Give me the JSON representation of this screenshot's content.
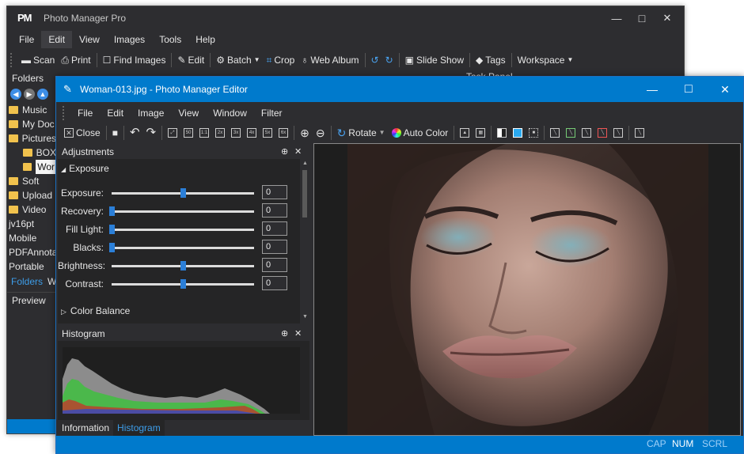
{
  "back_window": {
    "logo": "PM",
    "title": "Photo Manager Pro",
    "menu": [
      "File",
      "Edit",
      "View",
      "Images",
      "Tools",
      "Help"
    ],
    "active_menu": "Edit",
    "toolbar": [
      {
        "icon": "scan-icon",
        "label": "Scan"
      },
      {
        "icon": "print-icon",
        "label": "Print"
      },
      {
        "icon": "find-images-icon",
        "label": "Find Images"
      },
      {
        "icon": "edit-icon",
        "label": "Edit"
      },
      {
        "icon": "batch-icon",
        "label": "Batch"
      },
      {
        "icon": "crop-icon",
        "label": "Crop"
      },
      {
        "icon": "web-album-icon",
        "label": "Web Album"
      },
      {
        "icon": "slide-show-icon",
        "label": "Slide Show"
      },
      {
        "icon": "tags-icon",
        "label": "Tags"
      },
      {
        "icon": "",
        "label": "Workspace"
      }
    ],
    "folders_header": "Folders",
    "folders": [
      {
        "label": "Music",
        "folder": true,
        "indent": 0
      },
      {
        "label": "My Doc",
        "folder": true,
        "indent": 0
      },
      {
        "label": "Pictures",
        "folder": true,
        "indent": 0
      },
      {
        "label": "BOX",
        "folder": true,
        "indent": 1
      },
      {
        "label": "Wor",
        "folder": true,
        "indent": 1,
        "selected": true
      },
      {
        "label": "Soft",
        "folder": true,
        "indent": 0
      },
      {
        "label": "Upload",
        "folder": true,
        "indent": 0
      },
      {
        "label": "Video",
        "folder": true,
        "indent": 0
      },
      {
        "label": "jv16pt",
        "folder": false,
        "indent": 0
      },
      {
        "label": "Mobile",
        "folder": false,
        "indent": 0
      },
      {
        "label": "PDFAnnota",
        "folder": false,
        "indent": 0
      },
      {
        "label": "Portable",
        "folder": false,
        "indent": 0
      }
    ],
    "folders_tab": "Folders",
    "folders_tab_next": "W",
    "preview_label": "Preview",
    "task_panel_label": "Task Panel"
  },
  "front_window": {
    "title": "Woman-013.jpg - Photo Manager Editor",
    "menu": [
      "File",
      "Edit",
      "Image",
      "View",
      "Window",
      "Filter"
    ],
    "toolbar": {
      "close_label": "Close",
      "rotate_label": "Rotate",
      "auto_color_label": "Auto Color",
      "zoom_labels": [
        "50",
        "1:1",
        "2x",
        "3x",
        "4x",
        "5x",
        "6x"
      ]
    },
    "adjustments": {
      "title": "Adjustments",
      "section": "Exposure",
      "rows": [
        {
          "label": "Exposure:",
          "value": "0",
          "pos": 0.5
        },
        {
          "label": "Recovery:",
          "value": "0",
          "pos": 0.0
        },
        {
          "label": "Fill Light:",
          "value": "0",
          "pos": 0.0
        },
        {
          "label": "Blacks:",
          "value": "0",
          "pos": 0.0
        },
        {
          "label": "Brightness:",
          "value": "0",
          "pos": 0.5
        },
        {
          "label": "Contrast:",
          "value": "0",
          "pos": 0.5
        }
      ],
      "collapsed_section": "Color Balance"
    },
    "histogram": {
      "title": "Histogram"
    },
    "bottom_tabs": [
      "Information",
      "Histogram"
    ],
    "active_bottom_tab": "Histogram",
    "status": {
      "cap": "CAP",
      "num": "NUM",
      "scrl": "SCRL"
    }
  },
  "colors": {
    "accent": "#007acc",
    "dark_bg": "#2d2d30",
    "panel_bg": "#252526",
    "folder": "#f1c24d",
    "slider_thumb": "#2b7fd8"
  }
}
